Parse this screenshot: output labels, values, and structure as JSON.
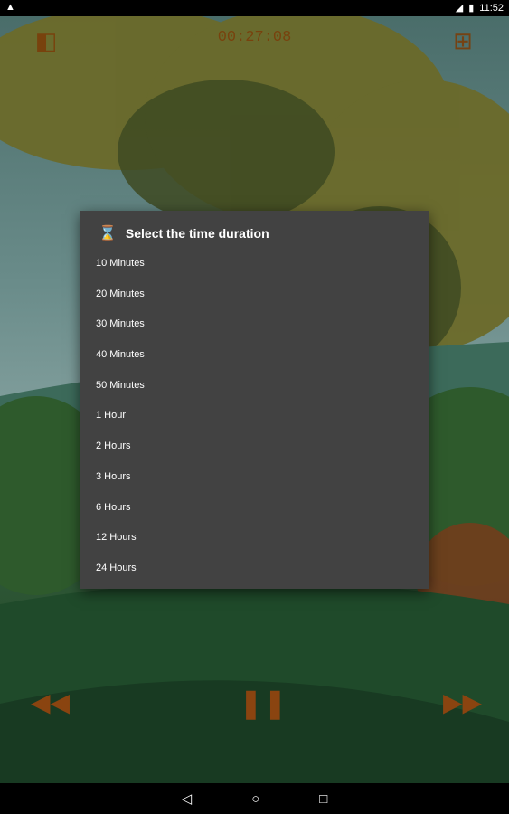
{
  "status_bar": {
    "time": "11:52"
  },
  "player": {
    "timer": "00:27:08"
  },
  "dialog": {
    "title": "Select the time duration",
    "items": [
      "10 Minutes",
      "20 Minutes",
      "30 Minutes",
      "40 Minutes",
      "50 Minutes",
      "1 Hour",
      "2 Hours",
      "3 Hours",
      "6 Hours",
      "12 Hours",
      "24 Hours"
    ]
  },
  "colors": {
    "accent": "#8a4410",
    "dialog_bg": "#424242"
  }
}
